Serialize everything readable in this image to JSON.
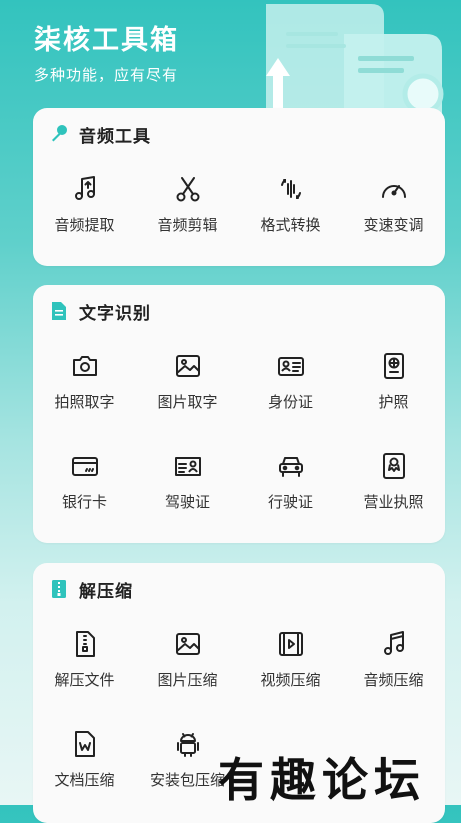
{
  "header": {
    "title": "柒核工具箱",
    "subtitle": "多种功能，应有尽有"
  },
  "colors": {
    "accent": "#2fc3bc",
    "icon": "#222222",
    "card": "#fafafa"
  },
  "sections": {
    "audio": {
      "title": "音频工具",
      "items": [
        {
          "label": "音频提取",
          "icon": "music-note-up-icon"
        },
        {
          "label": "音频剪辑",
          "icon": "scissors-icon"
        },
        {
          "label": "格式转换",
          "icon": "format-convert-icon"
        },
        {
          "label": "变速变调",
          "icon": "speedometer-icon"
        }
      ]
    },
    "ocr": {
      "title": "文字识别",
      "items": [
        {
          "label": "拍照取字",
          "icon": "camera-icon"
        },
        {
          "label": "图片取字",
          "icon": "image-icon"
        },
        {
          "label": "身份证",
          "icon": "id-card-icon"
        },
        {
          "label": "护照",
          "icon": "passport-icon"
        },
        {
          "label": "银行卡",
          "icon": "bank-card-icon"
        },
        {
          "label": "驾驶证",
          "icon": "driver-license-icon"
        },
        {
          "label": "行驶证",
          "icon": "car-icon"
        },
        {
          "label": "营业执照",
          "icon": "business-license-icon"
        }
      ]
    },
    "unzip": {
      "title": "解压缩",
      "items": [
        {
          "label": "解压文件",
          "icon": "zip-file-icon"
        },
        {
          "label": "图片压缩",
          "icon": "image-compress-icon"
        },
        {
          "label": "视频压缩",
          "icon": "video-file-icon"
        },
        {
          "label": "音频压缩",
          "icon": "music-note-icon"
        },
        {
          "label": "文档压缩",
          "icon": "word-doc-icon"
        },
        {
          "label": "安装包压缩",
          "icon": "android-icon"
        }
      ]
    }
  },
  "watermark": "有趣论坛"
}
